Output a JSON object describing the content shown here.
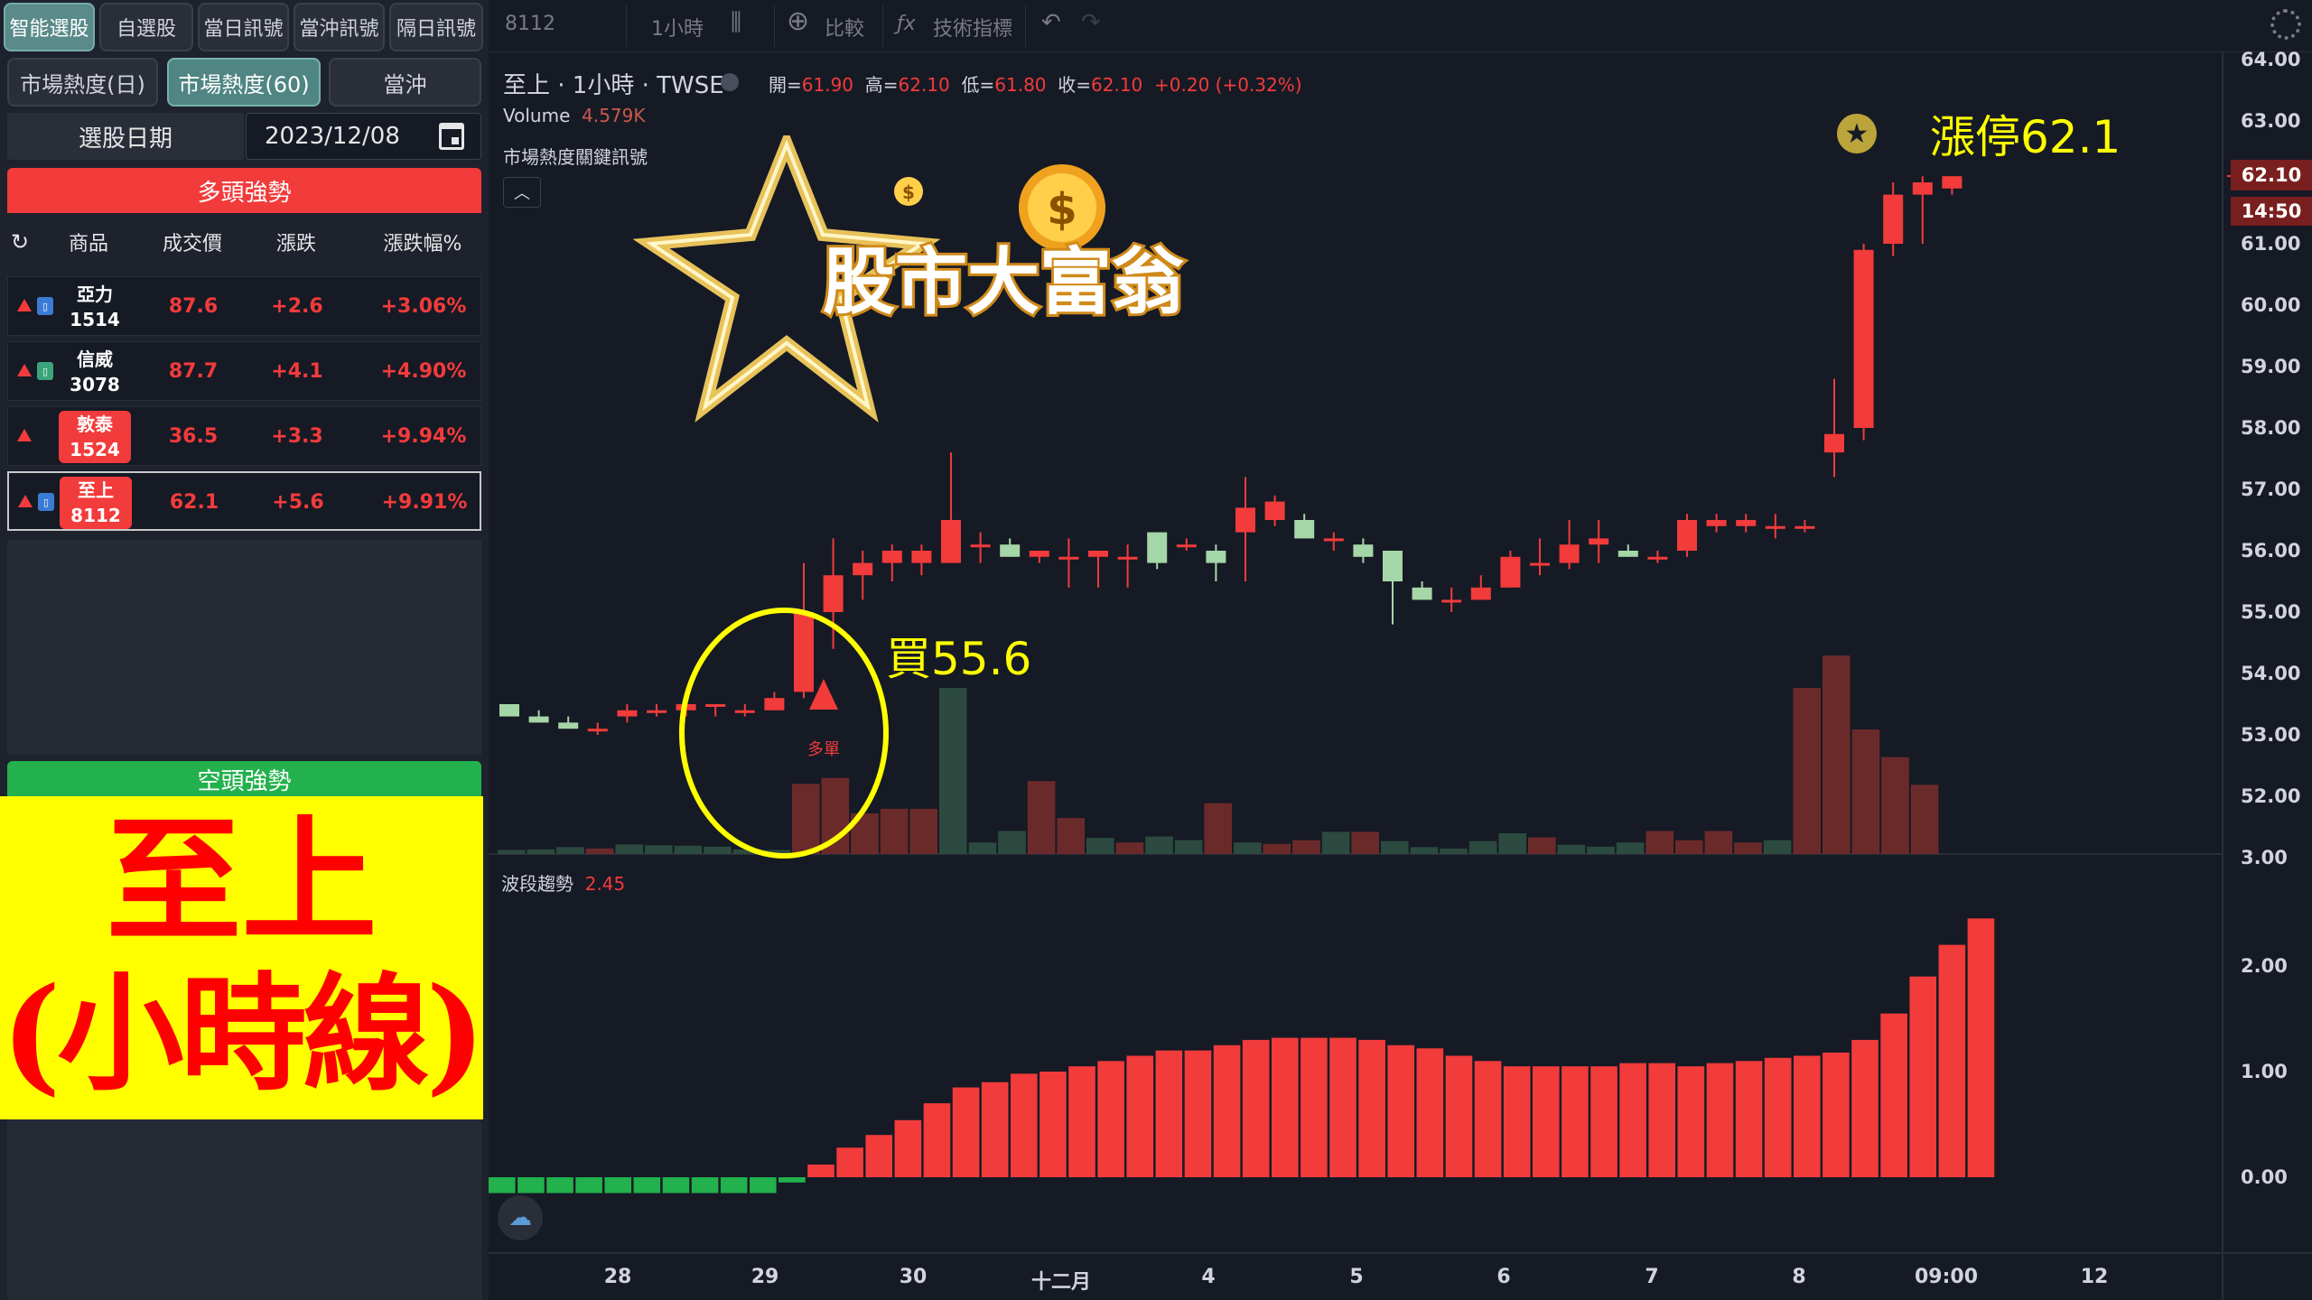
{
  "left": {
    "top_buttons": [
      "智能選股",
      "自選股",
      "當日訊號",
      "當沖訊號",
      "隔日訊號"
    ],
    "tabs": [
      "市場熱度(日)",
      "市場熱度(60)",
      "當沖"
    ],
    "date_label": "選股日期",
    "date_value": "2023/12/08",
    "bull_header": "多頭強勢",
    "columns": [
      "商品",
      "成交價",
      "漲跌",
      "漲跌幅%"
    ],
    "rows": [
      {
        "name": "亞力",
        "code": "1514",
        "price": "87.6",
        "change": "+2.6",
        "pct": "+3.06%"
      },
      {
        "name": "信威",
        "code": "3078",
        "price": "87.7",
        "change": "+4.1",
        "pct": "+4.90%"
      },
      {
        "name": "敦泰",
        "code": "1524",
        "price": "36.5",
        "change": "+3.3",
        "pct": "+9.94%"
      },
      {
        "name": "至上",
        "code": "8112",
        "price": "62.1",
        "change": "+5.6",
        "pct": "+9.91%"
      }
    ],
    "bear_header": "空頭強勢",
    "overlay_line1": "至上",
    "overlay_line2": "(小時線)"
  },
  "toolbar": {
    "symbol": "8112",
    "interval": "1小時",
    "compare": "比較",
    "indicators": "技術指標"
  },
  "legend": {
    "title": "至上 · 1小時 · TWSE",
    "open_label": "開=",
    "open": "61.90",
    "high_label": "高=",
    "high": "62.10",
    "low_label": "低=",
    "low": "61.80",
    "close_label": "收=",
    "close": "62.10",
    "change": "+0.20 (+0.32%)",
    "volume_label": "Volume",
    "volume_value": "4.579K",
    "indicator": "市場熱度關鍵訊號",
    "wave_label": "波段趨勢",
    "wave_value": "2.45",
    "signal_label": "多單"
  },
  "annotations": {
    "buy": "買55.6",
    "limit_up": "漲停62.1"
  },
  "logo_text": "股市大富翁",
  "axes": {
    "price_ticks": [
      "64.00",
      "63.00",
      "62.10",
      "61.00",
      "60.00",
      "59.00",
      "58.00",
      "57.00",
      "56.00",
      "55.00",
      "54.00",
      "53.00",
      "52.00",
      "3.00",
      "2.00",
      "1.00",
      "0.00"
    ],
    "price_tag": "62.10",
    "time_tag": "14:50",
    "x_ticks": [
      "28",
      "29",
      "30",
      "十二月",
      "4",
      "5",
      "6",
      "7",
      "8",
      "09:00",
      "12"
    ]
  },
  "colors": {
    "up": "#f23b3b",
    "down": "#a5d6a7",
    "bull": "#f23b3b",
    "bear": "#22b14c",
    "annotation": "#ffff00"
  },
  "chart_data": {
    "type": "candlestick",
    "candles": [
      {
        "o": 53.5,
        "h": 53.5,
        "l": 53.3,
        "c": 53.3
      },
      {
        "o": 53.3,
        "h": 53.4,
        "l": 53.2,
        "c": 53.2
      },
      {
        "o": 53.2,
        "h": 53.3,
        "l": 53.1,
        "c": 53.1
      },
      {
        "o": 53.1,
        "h": 53.2,
        "l": 53.0,
        "c": 53.1
      },
      {
        "o": 53.3,
        "h": 53.5,
        "l": 53.2,
        "c": 53.4
      },
      {
        "o": 53.4,
        "h": 53.5,
        "l": 53.3,
        "c": 53.4
      },
      {
        "o": 53.4,
        "h": 53.6,
        "l": 53.3,
        "c": 53.5
      },
      {
        "o": 53.5,
        "h": 53.5,
        "l": 53.3,
        "c": 53.5
      },
      {
        "o": 53.4,
        "h": 53.5,
        "l": 53.3,
        "c": 53.4
      },
      {
        "o": 53.4,
        "h": 53.7,
        "l": 53.4,
        "c": 53.6
      },
      {
        "o": 53.7,
        "h": 55.8,
        "l": 53.6,
        "c": 55.0
      },
      {
        "o": 55.0,
        "h": 56.2,
        "l": 54.4,
        "c": 55.6
      },
      {
        "o": 55.6,
        "h": 56.0,
        "l": 55.2,
        "c": 55.8
      },
      {
        "o": 55.8,
        "h": 56.1,
        "l": 55.5,
        "c": 56.0
      },
      {
        "o": 55.8,
        "h": 56.1,
        "l": 55.6,
        "c": 56.0
      },
      {
        "o": 55.8,
        "h": 57.6,
        "l": 55.8,
        "c": 56.5
      },
      {
        "o": 56.1,
        "h": 56.3,
        "l": 55.8,
        "c": 56.1
      },
      {
        "o": 56.1,
        "h": 56.2,
        "l": 55.9,
        "c": 55.9
      },
      {
        "o": 55.9,
        "h": 56.0,
        "l": 55.8,
        "c": 56.0
      },
      {
        "o": 55.9,
        "h": 56.2,
        "l": 55.4,
        "c": 55.9
      },
      {
        "o": 55.9,
        "h": 56.0,
        "l": 55.4,
        "c": 56.0
      },
      {
        "o": 55.9,
        "h": 56.1,
        "l": 55.4,
        "c": 55.9
      },
      {
        "o": 56.3,
        "h": 56.3,
        "l": 55.7,
        "c": 55.8
      },
      {
        "o": 56.1,
        "h": 56.2,
        "l": 56.0,
        "c": 56.1
      },
      {
        "o": 56.0,
        "h": 56.1,
        "l": 55.5,
        "c": 55.8
      },
      {
        "o": 56.3,
        "h": 57.2,
        "l": 55.5,
        "c": 56.7
      },
      {
        "o": 56.5,
        "h": 56.9,
        "l": 56.4,
        "c": 56.8
      },
      {
        "o": 56.5,
        "h": 56.6,
        "l": 56.2,
        "c": 56.2
      },
      {
        "o": 56.2,
        "h": 56.3,
        "l": 56.0,
        "c": 56.2
      },
      {
        "o": 56.1,
        "h": 56.2,
        "l": 55.8,
        "c": 55.9
      },
      {
        "o": 56.0,
        "h": 56.0,
        "l": 54.8,
        "c": 55.5
      },
      {
        "o": 55.4,
        "h": 55.5,
        "l": 55.2,
        "c": 55.2
      },
      {
        "o": 55.2,
        "h": 55.4,
        "l": 55.0,
        "c": 55.2
      },
      {
        "o": 55.2,
        "h": 55.6,
        "l": 55.2,
        "c": 55.4
      },
      {
        "o": 55.4,
        "h": 56.0,
        "l": 55.4,
        "c": 55.9
      },
      {
        "o": 55.8,
        "h": 56.2,
        "l": 55.6,
        "c": 55.8
      },
      {
        "o": 55.8,
        "h": 56.5,
        "l": 55.7,
        "c": 56.1
      },
      {
        "o": 56.1,
        "h": 56.5,
        "l": 55.8,
        "c": 56.2
      },
      {
        "o": 56.0,
        "h": 56.1,
        "l": 55.9,
        "c": 55.9
      },
      {
        "o": 55.9,
        "h": 56.0,
        "l": 55.8,
        "c": 55.9
      },
      {
        "o": 56.0,
        "h": 56.6,
        "l": 55.9,
        "c": 56.5
      },
      {
        "o": 56.4,
        "h": 56.6,
        "l": 56.3,
        "c": 56.5
      },
      {
        "o": 56.4,
        "h": 56.6,
        "l": 56.3,
        "c": 56.5
      },
      {
        "o": 56.4,
        "h": 56.6,
        "l": 56.2,
        "c": 56.4
      },
      {
        "o": 56.4,
        "h": 56.5,
        "l": 56.3,
        "c": 56.4
      },
      {
        "o": 57.6,
        "h": 58.8,
        "l": 57.2,
        "c": 57.9
      },
      {
        "o": 58.0,
        "h": 61.0,
        "l": 57.8,
        "c": 60.9
      },
      {
        "o": 61.0,
        "h": 62.0,
        "l": 60.8,
        "c": 61.8
      },
      {
        "o": 61.8,
        "h": 62.1,
        "l": 61.0,
        "c": 62.0
      },
      {
        "o": 61.9,
        "h": 62.1,
        "l": 61.8,
        "c": 62.1
      }
    ],
    "volume": [
      0.9,
      1.0,
      1.5,
      1.2,
      2.1,
      1.9,
      1.8,
      1.6,
      1.0,
      0.9,
      15.2,
      16.5,
      8.8,
      9.8,
      9.8,
      36.0,
      2.5,
      5.0,
      15.8,
      7.8,
      3.5,
      2.5,
      3.8,
      3.0,
      11.0,
      2.5,
      2.2,
      3.0,
      4.8,
      4.8,
      2.8,
      1.5,
      1.2,
      2.8,
      4.5,
      3.6,
      2.0,
      1.6,
      2.5,
      5.0,
      3.0,
      5.0,
      2.5,
      3.0,
      36.0,
      43.0,
      27.0,
      21.0,
      15.0
    ],
    "volume_up": [
      false,
      false,
      false,
      true,
      false,
      false,
      false,
      false,
      false,
      false,
      true,
      true,
      true,
      true,
      true,
      false,
      false,
      false,
      true,
      true,
      false,
      true,
      false,
      false,
      true,
      false,
      true,
      true,
      false,
      true,
      false,
      false,
      false,
      false,
      false,
      true,
      false,
      false,
      false,
      true,
      true,
      true,
      true,
      false,
      true,
      true,
      true,
      true,
      true
    ],
    "signal_candle_index": 10,
    "wave_trend": [
      -0.15,
      -0.15,
      -0.15,
      -0.15,
      -0.15,
      -0.15,
      -0.15,
      -0.15,
      -0.15,
      -0.15,
      -0.05,
      0.12,
      0.28,
      0.4,
      0.54,
      0.7,
      0.85,
      0.9,
      0.98,
      1.0,
      1.05,
      1.1,
      1.15,
      1.2,
      1.2,
      1.25,
      1.3,
      1.32,
      1.32,
      1.32,
      1.3,
      1.25,
      1.22,
      1.15,
      1.1,
      1.05,
      1.05,
      1.05,
      1.05,
      1.08,
      1.08,
      1.05,
      1.08,
      1.1,
      1.13,
      1.15,
      1.18,
      1.3,
      1.55,
      1.9,
      2.2,
      2.45
    ],
    "ylim_price": [
      51.0,
      64.0
    ],
    "ylim_wave": [
      -0.3,
      3.0
    ]
  }
}
